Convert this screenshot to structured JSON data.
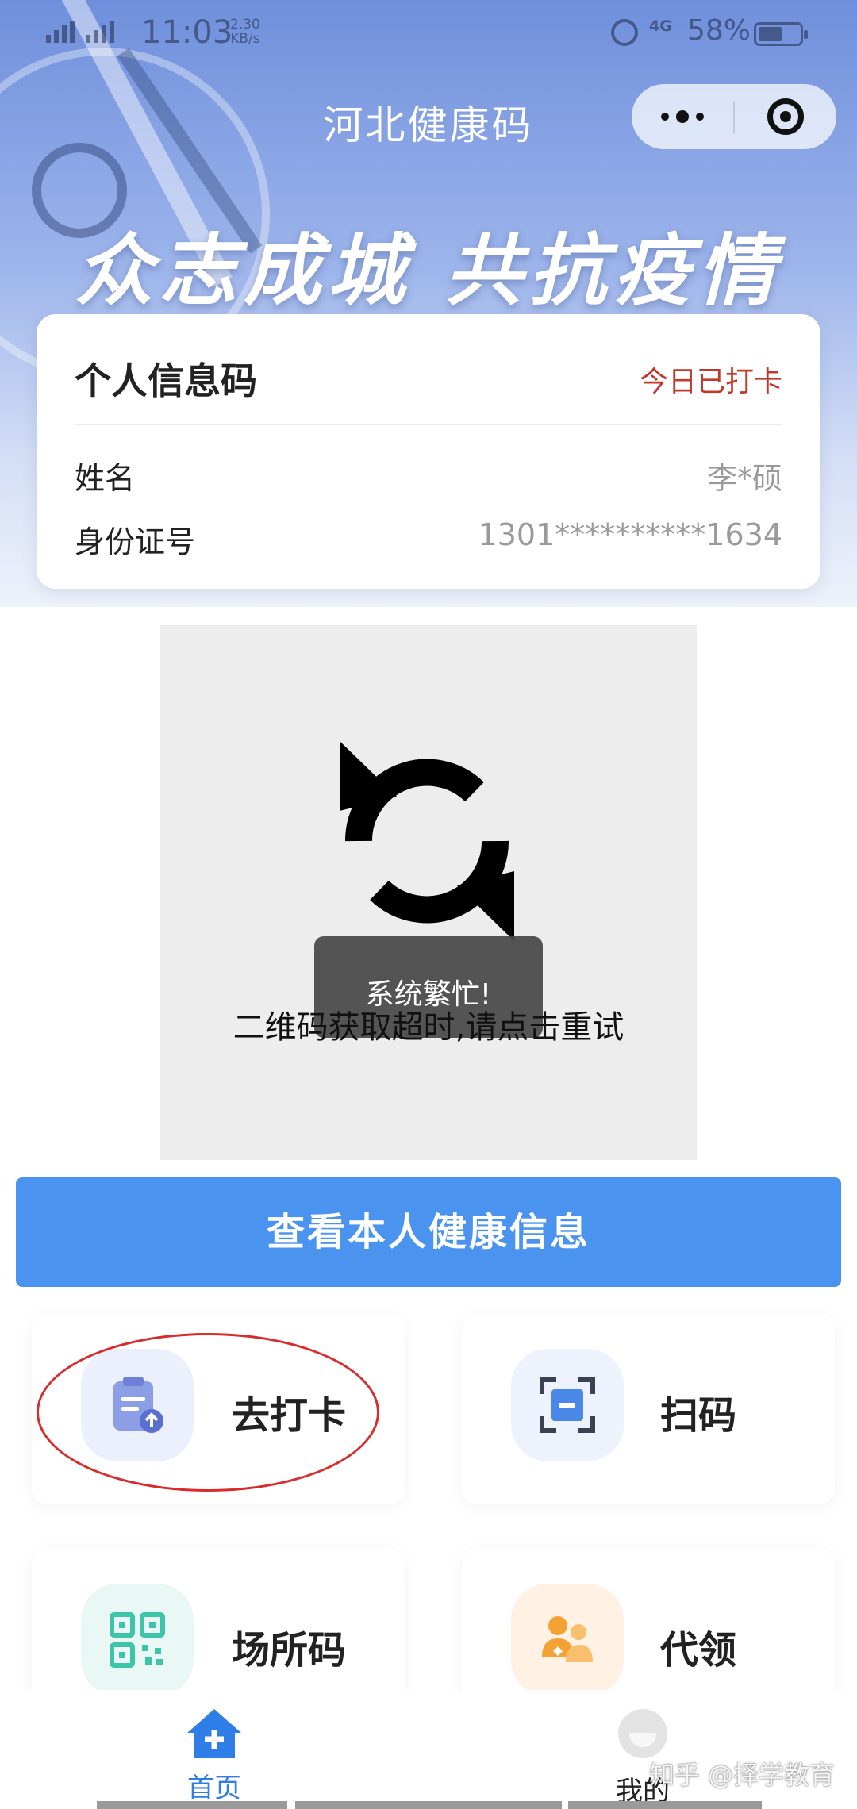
{
  "status_bar": {
    "time": "11:03",
    "net_rate": "2.30",
    "net_rate_unit": "KB/s",
    "network": "4G",
    "battery": "58%"
  },
  "header": {
    "title": "河北健康码",
    "slogan": "众志成城 共抗疫情"
  },
  "info_card": {
    "title": "个人信息码",
    "checkin_status": "今日已打卡",
    "rows": [
      {
        "label": "姓名",
        "value": "李*硕"
      },
      {
        "label": "身份证号",
        "value": "1301**********1634"
      }
    ]
  },
  "qr": {
    "toast": "系统繁忙!",
    "message": "二维码获取超时,请点击重试"
  },
  "main_button": {
    "label": "查看本人健康信息"
  },
  "grid": [
    {
      "label": "去打卡",
      "icon": "clipboard-upload-icon",
      "color": "#7b8fe0"
    },
    {
      "label": "扫码",
      "icon": "scan-icon",
      "color": "#4a88e8"
    },
    {
      "label": "场所码",
      "icon": "qr-code-icon",
      "color": "#3ec4a8"
    },
    {
      "label": "代领",
      "icon": "people-icon",
      "color": "#f5a235"
    }
  ],
  "tabbar": {
    "items": [
      {
        "label": "首页",
        "icon": "home-icon",
        "active": true
      },
      {
        "label": "我的",
        "icon": "avatar-icon",
        "active": false
      }
    ]
  },
  "watermark": "知乎 @择学教育",
  "colors": {
    "primary": "#4a94f0",
    "checkin_red": "#c0392b",
    "tab_active": "#2f7ee8"
  }
}
